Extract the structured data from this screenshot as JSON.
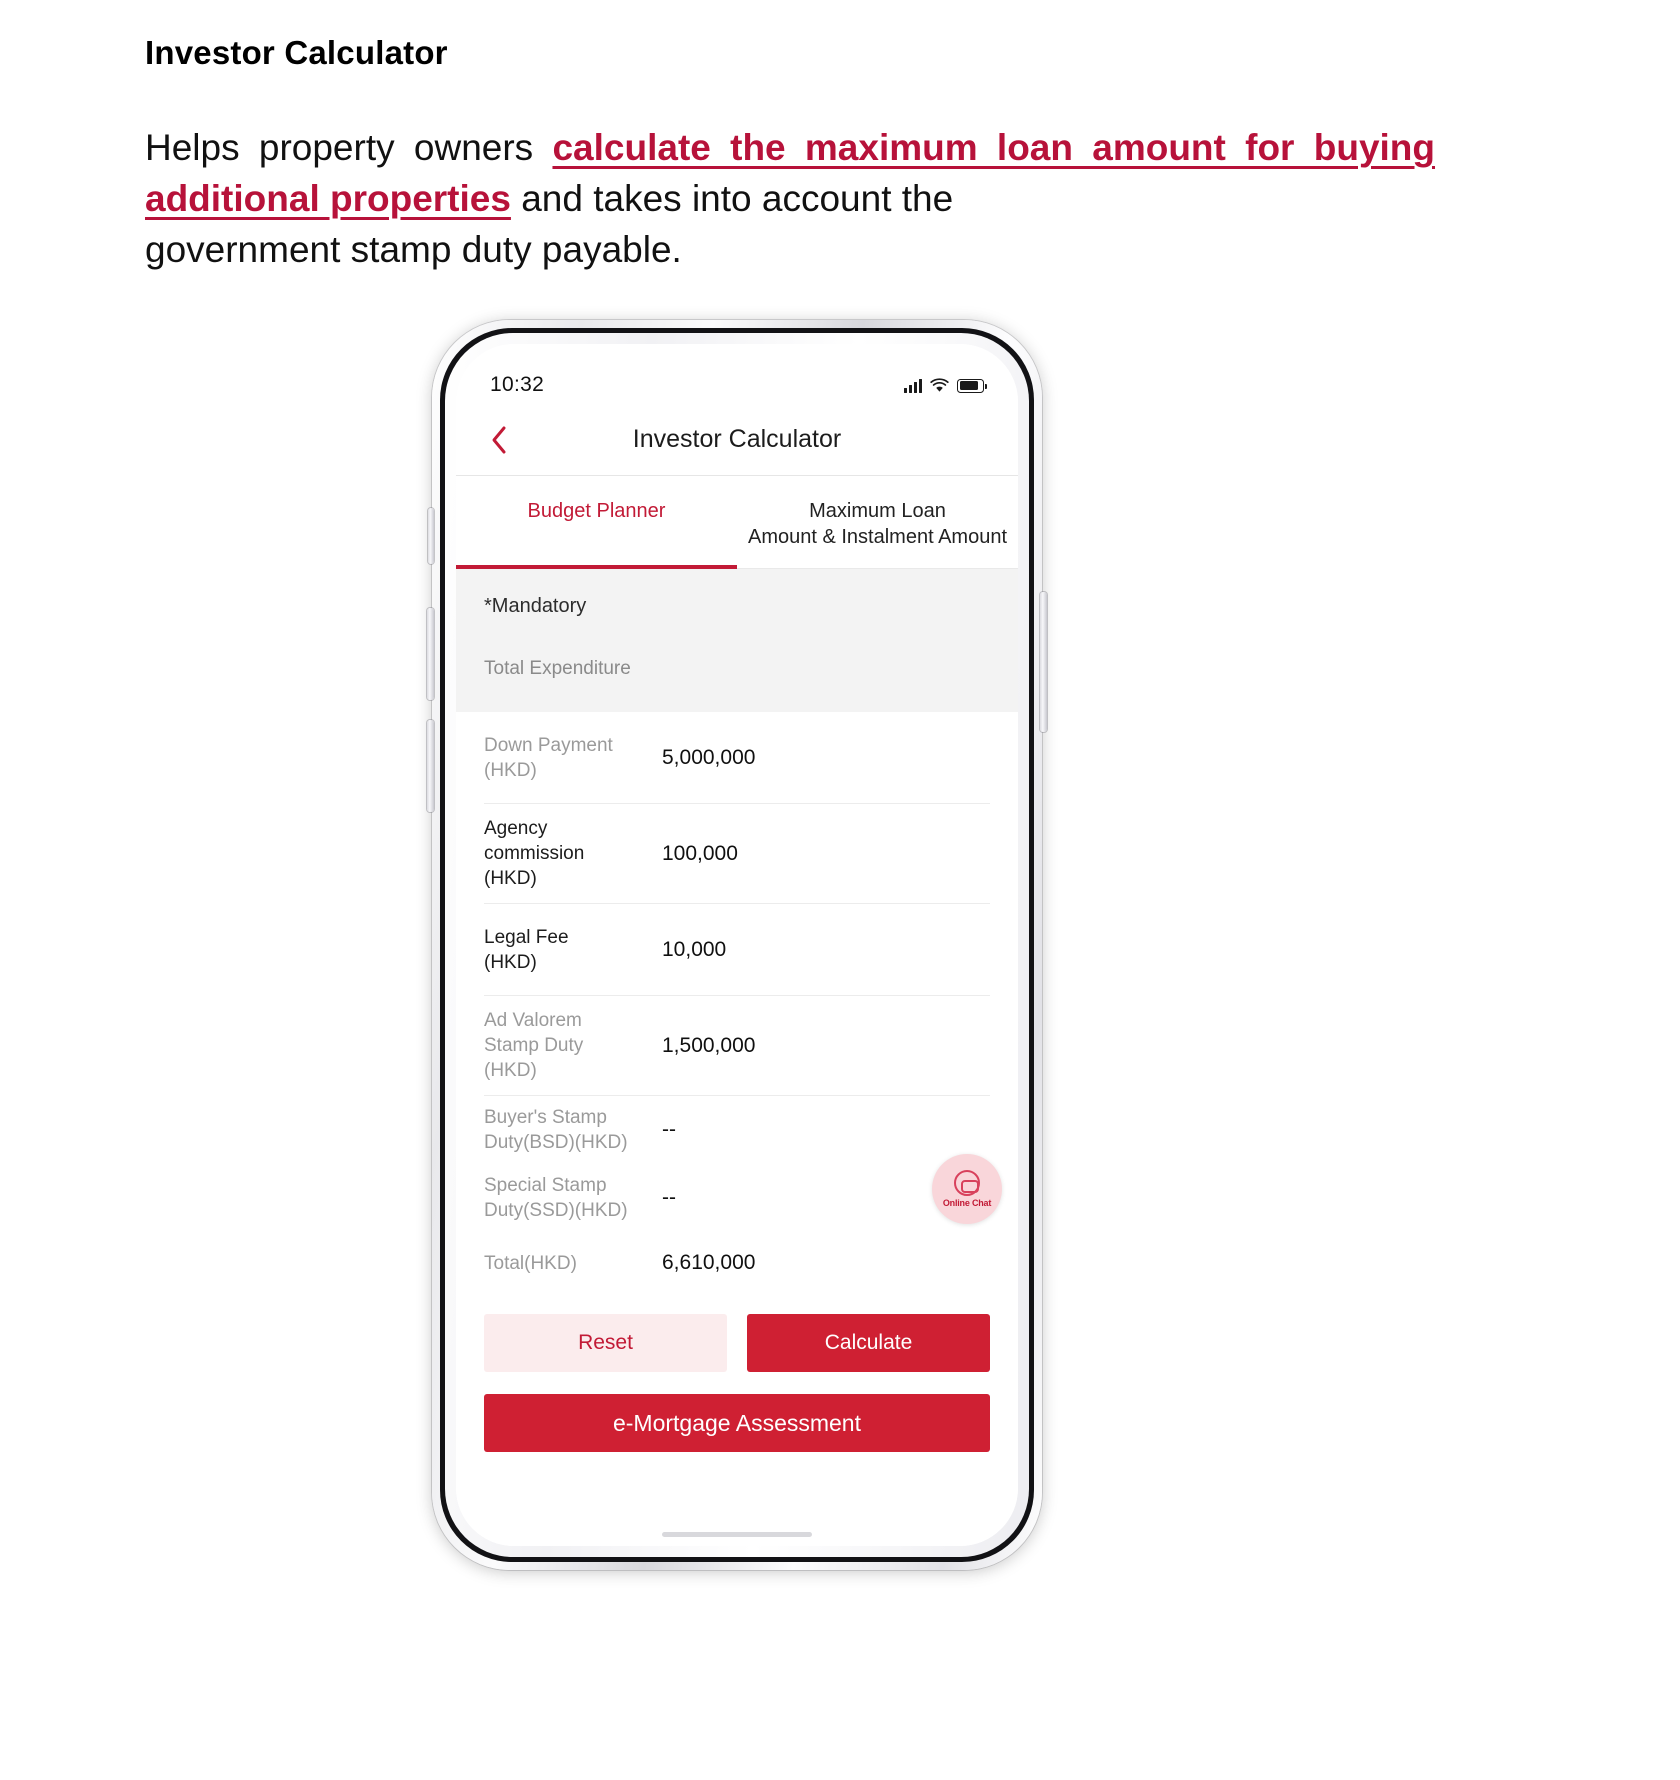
{
  "document": {
    "title": "Investor Calculator",
    "paragraph": {
      "lead": "Helps property owners",
      "highlight": "calculate the maximum loan amount for buying additional properties",
      "tail": "and takes into account the",
      "last_line": "government stamp duty payable."
    }
  },
  "phone": {
    "status": {
      "time": "10:32",
      "signal_icon": "cellular-signal-icon",
      "wifi_icon": "wifi-icon",
      "battery_icon": "battery-icon"
    },
    "navbar": {
      "back_icon": "chevron-left-icon",
      "title": "Investor Calculator"
    },
    "tabs": [
      {
        "label": "Budget Planner",
        "active": true
      },
      {
        "label": "Maximum Loan\nAmount & Instalment Amount",
        "active": false
      }
    ],
    "tab_labels": {
      "budget_planner": "Budget Planner",
      "max_loan_line1": "Maximum Loan",
      "max_loan_line2": "Amount & Instalment Amount"
    },
    "section": {
      "mandatory_note": "*Mandatory",
      "group_heading": "Total Expenditure"
    },
    "fields": [
      {
        "label_line1": "Down Payment",
        "label_line2": "(HKD)",
        "value": "5,000,000",
        "muted": true
      },
      {
        "label_line1": "Agency",
        "label_line2": "commission",
        "label_line3": "(HKD)",
        "value": "100,000",
        "muted": false
      },
      {
        "label_line1": "Legal Fee",
        "label_line2": "(HKD)",
        "value": "10,000",
        "muted": false
      },
      {
        "label_line1": "Ad Valorem",
        "label_line2": "Stamp Duty",
        "label_line3": "(HKD)",
        "value": "1,500,000",
        "muted": true
      },
      {
        "label_line1": "Buyer's Stamp",
        "label_line2": "Duty(BSD)(HKD)",
        "value": "--",
        "muted": true
      },
      {
        "label_line1": "Special Stamp",
        "label_line2": "Duty(SSD)(HKD)",
        "value": "--",
        "muted": true
      },
      {
        "label_line1": "Total(HKD)",
        "value": "6,610,000",
        "muted": true
      }
    ],
    "buttons": {
      "reset": "Reset",
      "calculate": "Calculate",
      "emortgage": "e-Mortgage Assessment"
    },
    "chat": {
      "label": "Online Chat",
      "icon": "chat-bubble-icon"
    }
  },
  "colors": {
    "brand_red": "#c21a36",
    "button_red": "#cf2033",
    "reset_bg": "#fbeced",
    "panel_grey": "#f3f3f3",
    "muted_text": "#9a9a9a"
  }
}
